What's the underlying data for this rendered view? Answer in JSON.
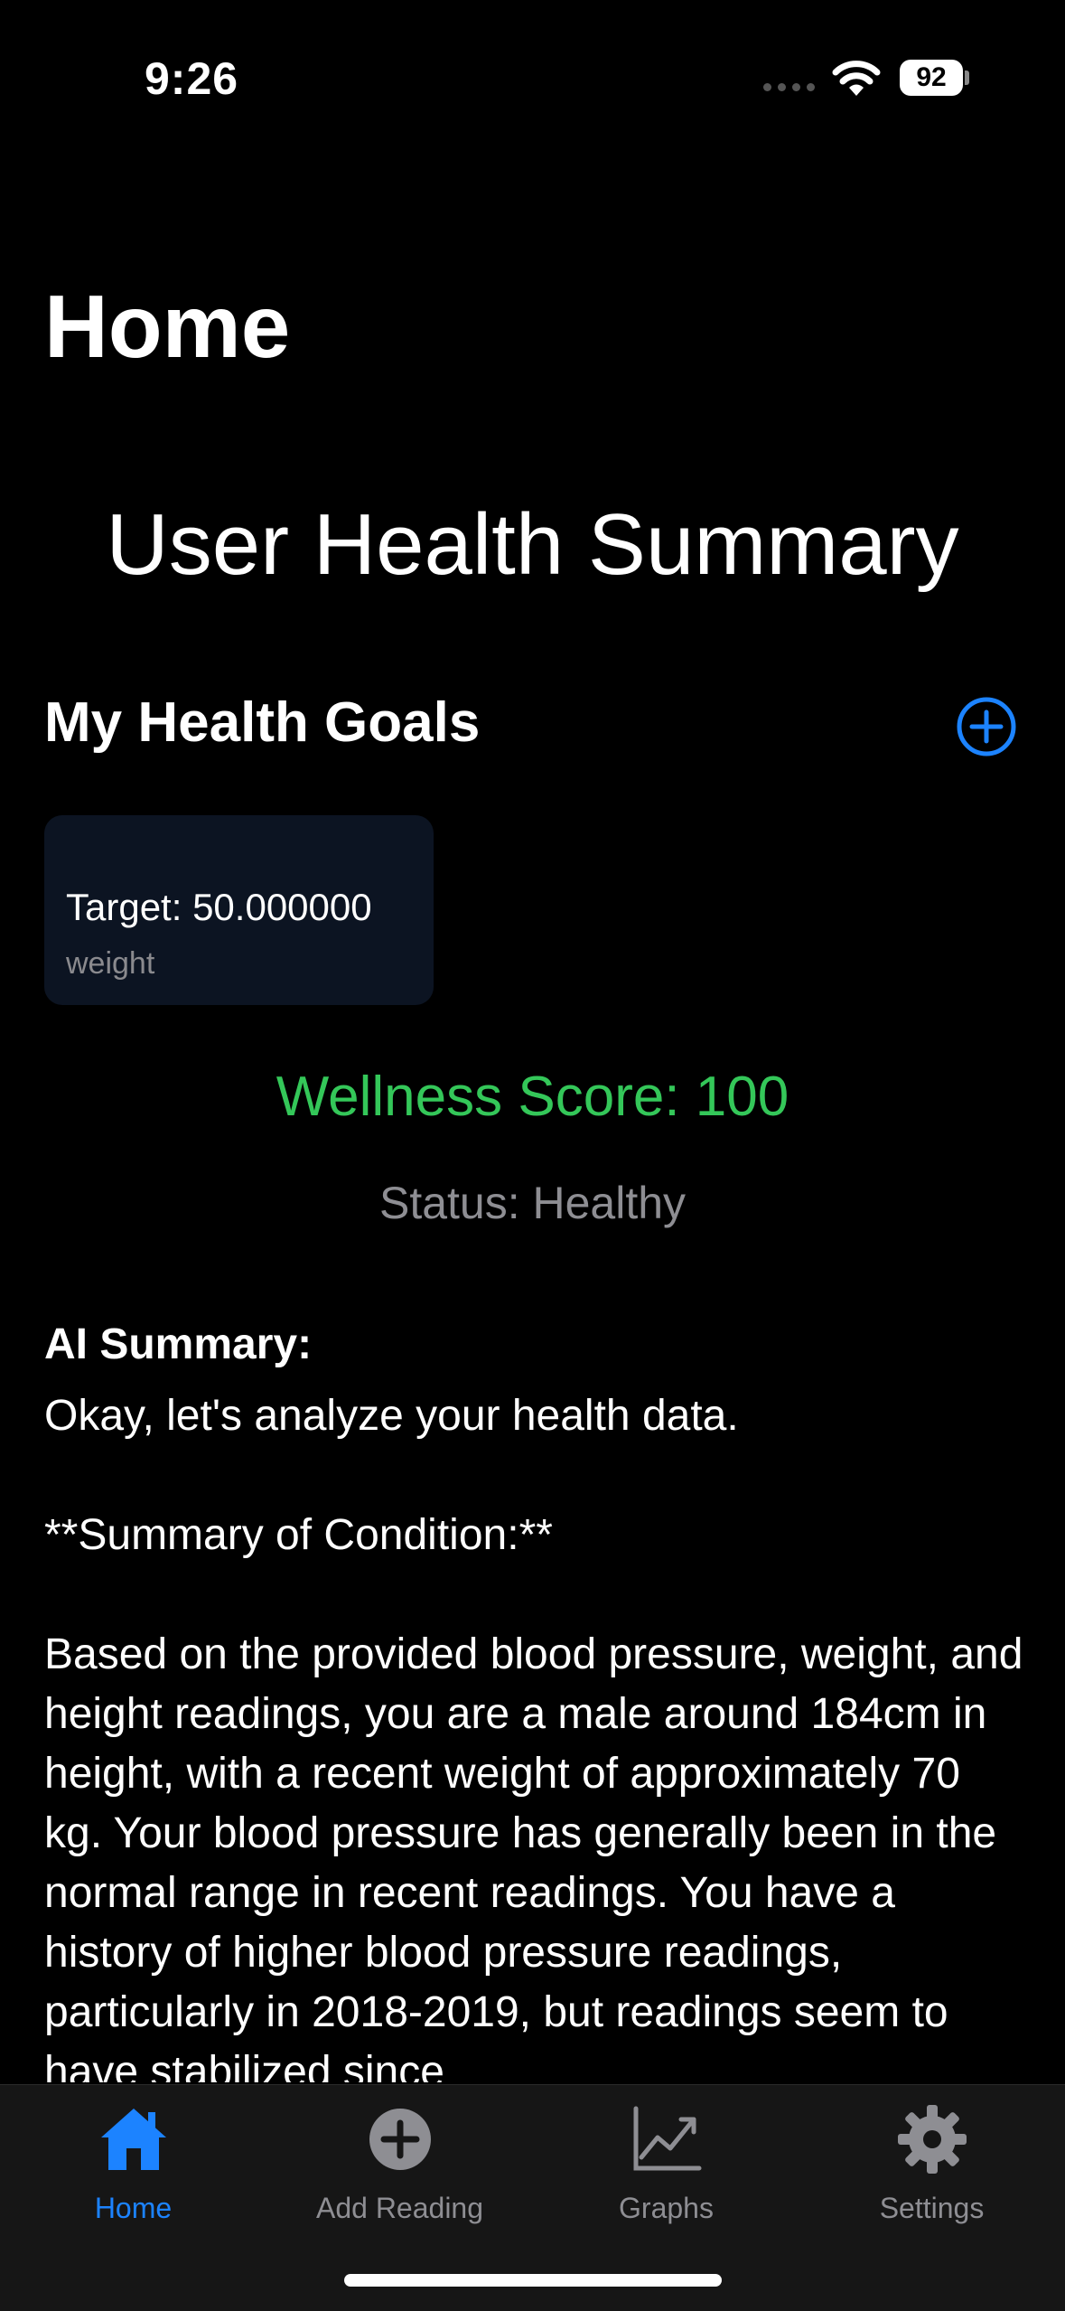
{
  "status_bar": {
    "time": "9:26",
    "battery": "92"
  },
  "page_title": "Home",
  "summary_title": "User Health Summary",
  "goals": {
    "heading": "My Health Goals",
    "add_icon": "plus-circle-icon",
    "items": [
      {
        "target": "Target: 50.000000",
        "metric": "weight"
      }
    ]
  },
  "wellness_score": "Wellness Score: 100",
  "status": "Status: Healthy",
  "ai_summary": {
    "label": "AI Summary:",
    "paragraphs": [
      "Okay, let's analyze your health data.",
      "**Summary of Condition:**",
      "Based on the provided blood pressure, weight, and height readings, you are a male around 184cm in height, with a recent weight of approximately 70 kg. Your blood pressure has generally been in the normal range in recent readings. You have a history of higher blood pressure readings, particularly in 2018-2019, but readings seem to have stabilized since"
    ]
  },
  "tabs": [
    {
      "label": "Home",
      "icon": "house-icon",
      "active": true
    },
    {
      "label": "Add Reading",
      "icon": "plus-circle-fill-icon",
      "active": false
    },
    {
      "label": "Graphs",
      "icon": "chart-line-icon",
      "active": false
    },
    {
      "label": "Settings",
      "icon": "gear-icon",
      "active": false
    }
  ],
  "colors": {
    "accent": "#1c83ff",
    "wellness": "#34c759",
    "secondary": "#8e8e93",
    "card": "#0c1422",
    "tabbar": "#161616"
  }
}
